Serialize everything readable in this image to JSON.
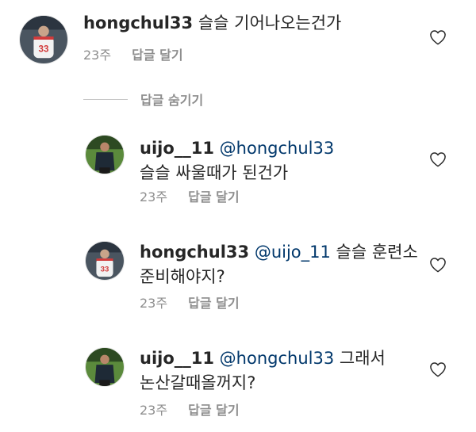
{
  "comments": [
    {
      "username": "hongchul33",
      "mention": "",
      "text": " 슬슬 기어나오는건가",
      "time": "23주",
      "reply_label": "답글 달기",
      "avatar": "avatar-icon-jersey-33",
      "heart": "heart-outline-icon"
    },
    {
      "username": "uijo__11",
      "mention": " @hongchul33",
      "text": " 슬슬 싸울때가 된건가",
      "time": "23주",
      "reply_label": "답글 달기",
      "avatar": "avatar-icon-player",
      "heart": "heart-outline-icon"
    },
    {
      "username": "hongchul33",
      "mention": " @uijo_11",
      "text": " 슬슬 훈련소 준비해야지?",
      "time": "23주",
      "reply_label": "답글 달기",
      "avatar": "avatar-icon-jersey-33",
      "heart": "heart-outline-icon"
    },
    {
      "username": "uijo__11",
      "mention": " @hongchul33",
      "text": " 그래서 논산갈때올꺼지?",
      "time": "23주",
      "reply_label": "답글 달기",
      "avatar": "avatar-icon-player",
      "heart": "heart-outline-icon"
    }
  ],
  "hide_replies_label": "답글 숨기기",
  "colors": {
    "text": "#262626",
    "mention": "#00376b",
    "meta": "#8e8e8e",
    "divider": "#c7c7c7"
  }
}
